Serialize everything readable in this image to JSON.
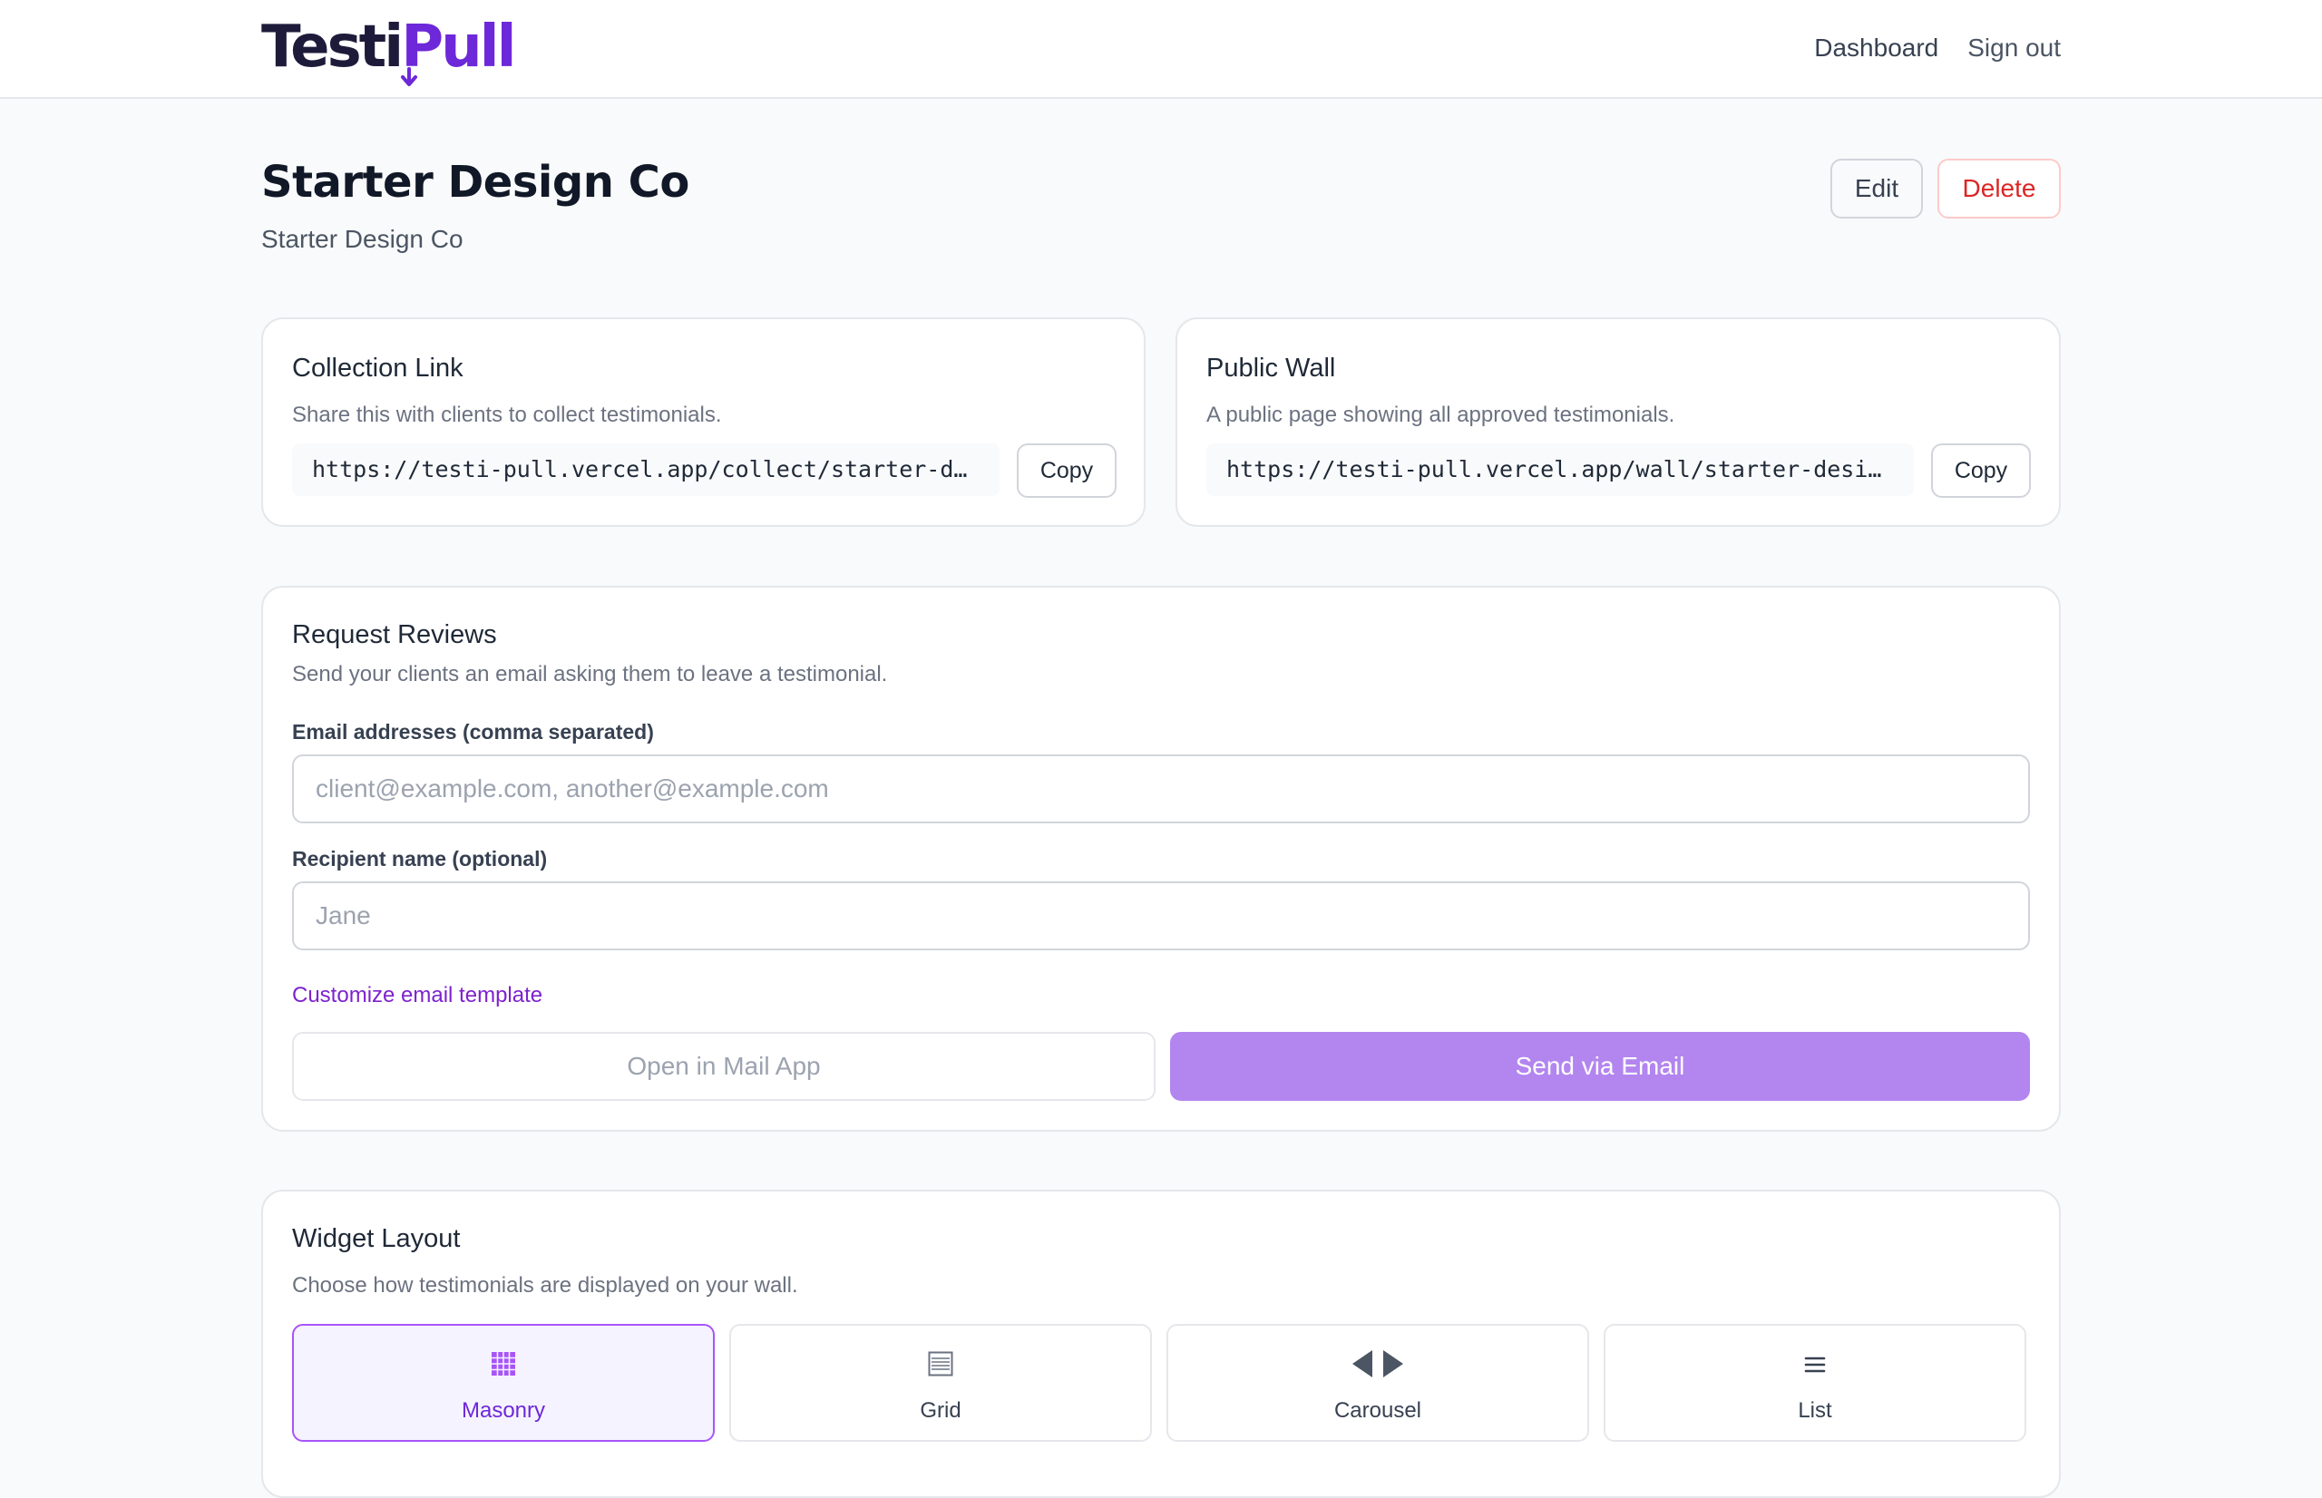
{
  "header": {
    "logo_part1": "Testi",
    "logo_part2": "Pull",
    "nav": {
      "dashboard": "Dashboard",
      "sign_out": "Sign out"
    }
  },
  "page": {
    "title": "Starter Design Co",
    "subtitle": "Starter Design Co",
    "edit_label": "Edit",
    "delete_label": "Delete"
  },
  "collection_link": {
    "title": "Collection Link",
    "description": "Share this with clients to collect testimonials.",
    "url": "https://testi-pull.vercel.app/collect/starter-design-co",
    "copy_label": "Copy"
  },
  "public_wall": {
    "title": "Public Wall",
    "description": "A public page showing all approved testimonials.",
    "url": "https://testi-pull.vercel.app/wall/starter-design-co",
    "copy_label": "Copy"
  },
  "request_reviews": {
    "title": "Request Reviews",
    "description": "Send your clients an email asking them to leave a testimonial.",
    "email_label": "Email addresses (comma separated)",
    "email_placeholder": "client@example.com, another@example.com",
    "email_value": "",
    "name_label": "Recipient name (optional)",
    "name_placeholder": "Jane",
    "name_value": "",
    "customize_link": "Customize email template",
    "open_mail_label": "Open in Mail App",
    "send_email_label": "Send via Email"
  },
  "widget_layout": {
    "title": "Widget Layout",
    "description": "Choose how testimonials are displayed on your wall.",
    "selected": "Masonry",
    "options": [
      {
        "label": "Masonry",
        "icon": "masonry-icon"
      },
      {
        "label": "Grid",
        "icon": "grid-icon"
      },
      {
        "label": "Carousel",
        "icon": "carousel-icon"
      },
      {
        "label": "List",
        "icon": "list-icon"
      }
    ]
  },
  "colors": {
    "brand_purple": "#6d28d9",
    "send_button": "#b385ef",
    "delete_red": "#dc2626"
  }
}
